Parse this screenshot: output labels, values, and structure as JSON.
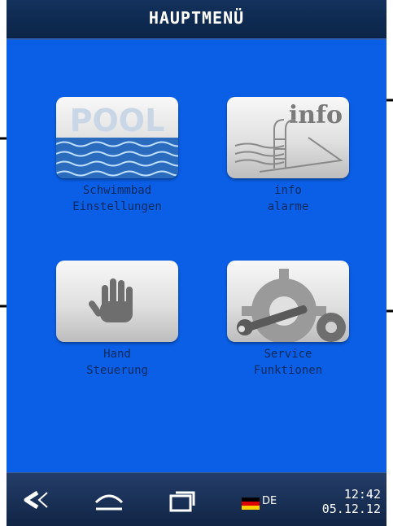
{
  "header": {
    "title": "HAUPTMENÜ"
  },
  "tiles": [
    {
      "icon": "pool-icon",
      "icon_text": "POOL",
      "label_line1": "Schwimmbad",
      "label_line2": "Einstellungen"
    },
    {
      "icon": "info-ladder-icon",
      "icon_text": "info",
      "label_line1": "info",
      "label_line2": "alarme"
    },
    {
      "icon": "hand-icon",
      "label_line1": "Hand",
      "label_line2": "Steuerung"
    },
    {
      "icon": "gear-wrench-icon",
      "label_line1": "Service",
      "label_line2": "Funktionen"
    }
  ],
  "bottombar": {
    "back_icon": "back-icon",
    "home_icon": "home-icon",
    "recent_icon": "recent-apps-icon",
    "language": "DE",
    "flag_icon": "german-flag-icon",
    "time": "12:42",
    "date": "05.12.12"
  },
  "colors": {
    "screen_background": "#0a5fe6",
    "titlebar": "#12315c",
    "bottombar": "#1a3257",
    "label_text": "#0a2a5e",
    "tile_background": "#e0e0e0"
  }
}
